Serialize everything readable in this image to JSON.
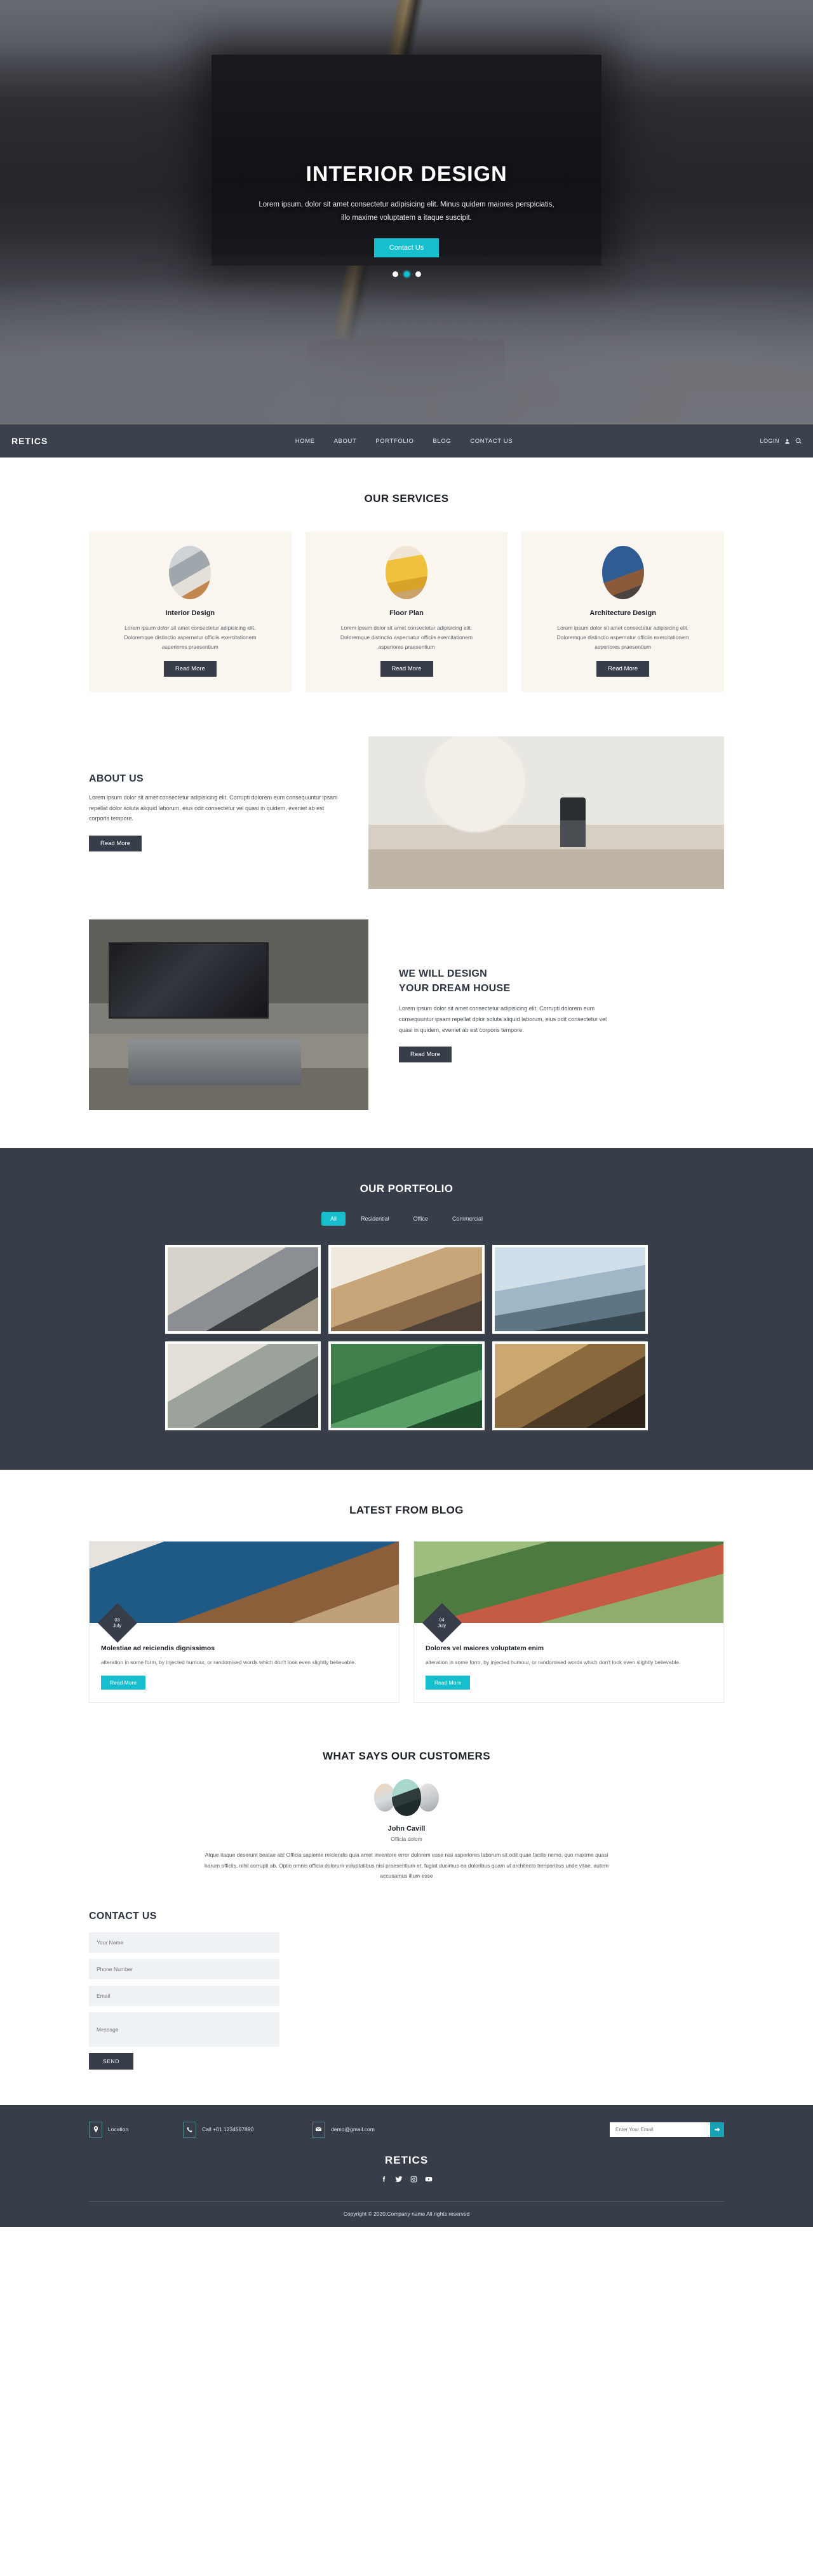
{
  "brand": "RETICS",
  "colors": {
    "accent": "#17bfce",
    "dark": "#373e4a",
    "cream": "#faf5ef"
  },
  "nav": {
    "logo": "RETICS",
    "links": [
      "HOME",
      "ABOUT",
      "PORTFOLIO",
      "BLOG",
      "CONTACT US"
    ],
    "login_label": "LOGIN"
  },
  "hero": {
    "title": "INTERIOR DESIGN",
    "subtitle": "Lorem ipsum, dolor sit amet consectetur adipisicing elit. Minus quidem maiores perspiciatis, illo maxime voluptatem a itaque suscipit.",
    "cta": "Contact Us",
    "slides": 3,
    "active_slide": 2
  },
  "services": {
    "title": "OUR SERVICES",
    "read_more": "Read More",
    "items": [
      {
        "name": "Interior Design",
        "desc": "Lorem ipsum dolor sit amet consectetur adipisicing elit. Doloremque distinctio aspernatur officiis exercitationem asperiores praesentium"
      },
      {
        "name": "Floor Plan",
        "desc": "Lorem ipsum dolor sit amet consectetur adipisicing elit. Doloremque distinctio aspernatur officiis exercitationem asperiores praesentium"
      },
      {
        "name": "Architecture Design",
        "desc": "Lorem ipsum dolor sit amet consectetur adipisicing elit. Doloremque distinctio aspernatur officiis exercitationem asperiores praesentium"
      }
    ]
  },
  "about": {
    "title": "ABOUT US",
    "body": "Lorem ipsum dolor sit amet consectetur adipisicing elit. Corrupti dolorem eum consequuntur ipsam repellat dolor soluta aliquid laborum, eius odit consectetur vel quasi in quidem, eveniet ab est corporis tempore.",
    "cta": "Read More"
  },
  "dream": {
    "title_line1": "WE WILL DESIGN",
    "title_line2": "YOUR DREAM HOUSE",
    "body": "Lorem ipsum dolor sit amet consectetur adipisicing elit. Corrupti dolorem eum consequuntur ipsam repellat dolor soluta aliquid laborum, eius odit consectetur vel quasi in quidem, eveniet ab est corporis tempore.",
    "cta": "Read More"
  },
  "portfolio": {
    "title": "OUR PORTFOLIO",
    "filters": [
      "All",
      "Residential",
      "Office",
      "Commercial"
    ],
    "active_filter": "All",
    "item_count": 6
  },
  "blog": {
    "title": "LATEST FROM BLOG",
    "posts": [
      {
        "day": "03",
        "month": "July",
        "title": "Molestiae ad reiciendis dignissimos",
        "desc": "alteration in some form, by injected humour, or randomised words which don't look even slightly believable.",
        "cta": "Read More"
      },
      {
        "day": "04",
        "month": "July",
        "title": "Dolores vel maiores voluptatem enim",
        "desc": "alteration in some form, by injected humour, or randomised words which don't look even slightly believable.",
        "cta": "Read More"
      }
    ]
  },
  "testimonial": {
    "title": "WHAT SAYS OUR CUSTOMERS",
    "name": "John Cavill",
    "role": "Officia dolom",
    "quote": "Atque itaque deserunt beatae ab! Officia sapiente reiciendis quia amet inventore error dolorem esse nisi asperiores laborum sit odit quae facilis nemo, quo maxime quasi harum officiis, nihil corrupti ab. Optio omnis officia dolorum voluptatibus nisi praesentium et, fugiat ducimus ea doloribus quam ut architecto temporibus unde vitae, autem accusamus illum esse"
  },
  "contact": {
    "title": "CONTACT US",
    "fields": {
      "name_placeholder": "Your Name",
      "phone_placeholder": "Phone Number",
      "email_placeholder": "Email",
      "message_placeholder": "Message"
    },
    "send_label": "SEND"
  },
  "footer": {
    "location": "Location",
    "phone": "Call +01 1234567890",
    "email": "demo@gmail.com",
    "subscribe_placeholder": "Enter Your Email",
    "brand": "RETICS",
    "socials": [
      "facebook-icon",
      "twitter-icon",
      "instagram-icon",
      "youtube-icon"
    ],
    "copyright": "Copyright © 2020.Company name All rights reserved"
  }
}
